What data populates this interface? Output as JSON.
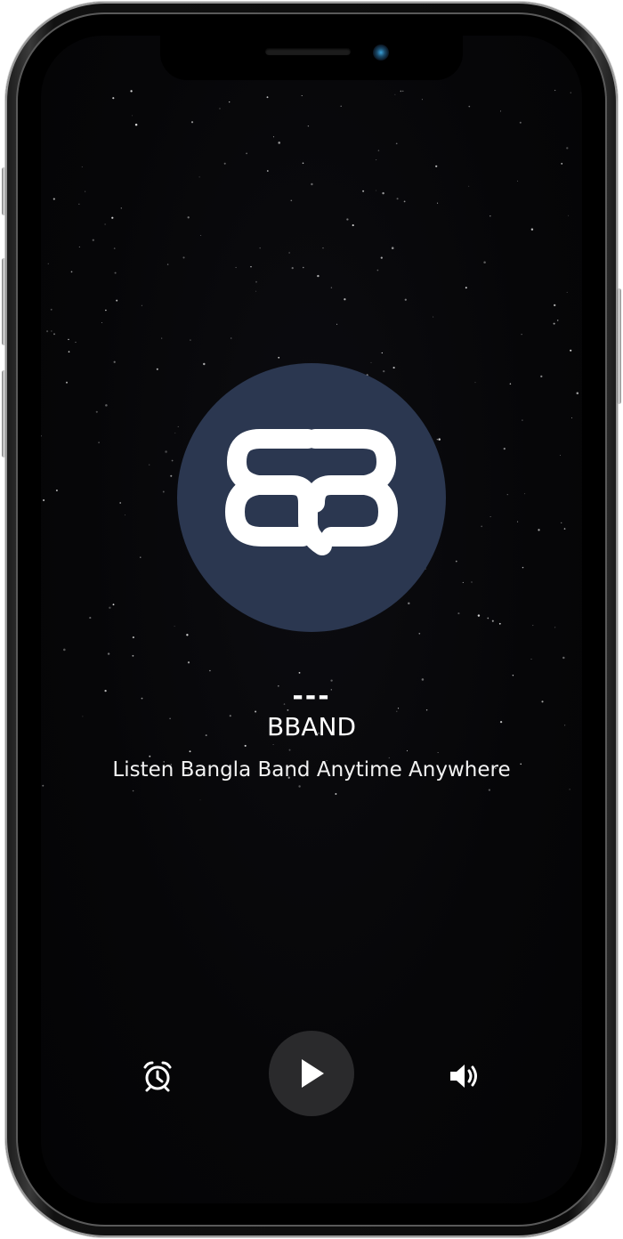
{
  "now_playing": {
    "track": "---",
    "app_name": "BBAND",
    "tagline": "Listen Bangla Band Anytime Anywhere"
  },
  "logo": {
    "icon": "bband-logo-icon",
    "background_color": "#2b3750",
    "mark_color": "#ffffff"
  },
  "controls": {
    "alarm_icon": "alarm-clock-icon",
    "play_icon": "play-icon",
    "volume_icon": "volume-icon"
  },
  "colors": {
    "screen_background": "#060608",
    "text": "#ffffff",
    "play_button_background": "#2a2a2c"
  }
}
